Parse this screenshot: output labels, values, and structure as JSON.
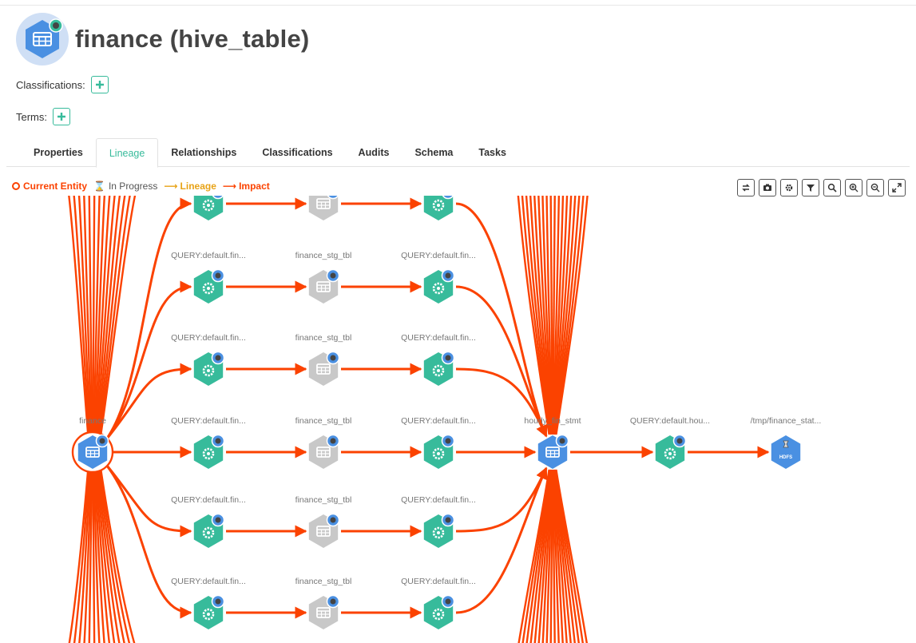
{
  "entity": {
    "title": "finance (hive_table)",
    "icon": "hive-table-icon"
  },
  "classifications": {
    "label": "Classifications:"
  },
  "terms": {
    "label": "Terms:"
  },
  "tabs": [
    {
      "label": "Properties",
      "active": false
    },
    {
      "label": "Lineage",
      "active": true
    },
    {
      "label": "Relationships",
      "active": false
    },
    {
      "label": "Classifications",
      "active": false
    },
    {
      "label": "Audits",
      "active": false
    },
    {
      "label": "Schema",
      "active": false
    },
    {
      "label": "Tasks",
      "active": false
    }
  ],
  "legend": {
    "current_entity": "Current Entity",
    "in_progress": "In Progress",
    "lineage": "Lineage",
    "impact": "Impact"
  },
  "toolbar": [
    "reset-icon",
    "camera-icon",
    "settings-icon",
    "filter-icon",
    "search-icon",
    "zoom-in-icon",
    "zoom-out-icon",
    "fullscreen-icon"
  ],
  "colors": {
    "accent": "#37bb9b",
    "impact": "#fb4200",
    "lineage": "#e8a317",
    "process": "#37bb9b",
    "dataset": "#4a90e2",
    "deleted": "#c8c8c8"
  },
  "graph": {
    "rows": [
      {
        "q1": "",
        "tbl": "",
        "q2": ""
      },
      {
        "q1": "QUERY:default.fin...",
        "tbl": "finance_stg_tbl",
        "q2": "QUERY:default.fin..."
      },
      {
        "q1": "QUERY:default.fin...",
        "tbl": "finance_stg_tbl",
        "q2": "QUERY:default.fin..."
      },
      {
        "q1": "QUERY:default.fin...",
        "tbl": "finance_stg_tbl",
        "q2": "QUERY:default.fin..."
      },
      {
        "q1": "QUERY:default.fin...",
        "tbl": "finance_stg_tbl",
        "q2": "QUERY:default.fin..."
      },
      {
        "q1": "QUERY:default.fin...",
        "tbl": "finance_stg_tbl",
        "q2": "QUERY:default.fin..."
      }
    ],
    "source_label": "finance",
    "target_label": "hourly_fin_stmt",
    "query_label": "QUERY:default.hou...",
    "hdfs_label": "/tmp/finance_stat...",
    "hdfs_text": "HDFS"
  }
}
